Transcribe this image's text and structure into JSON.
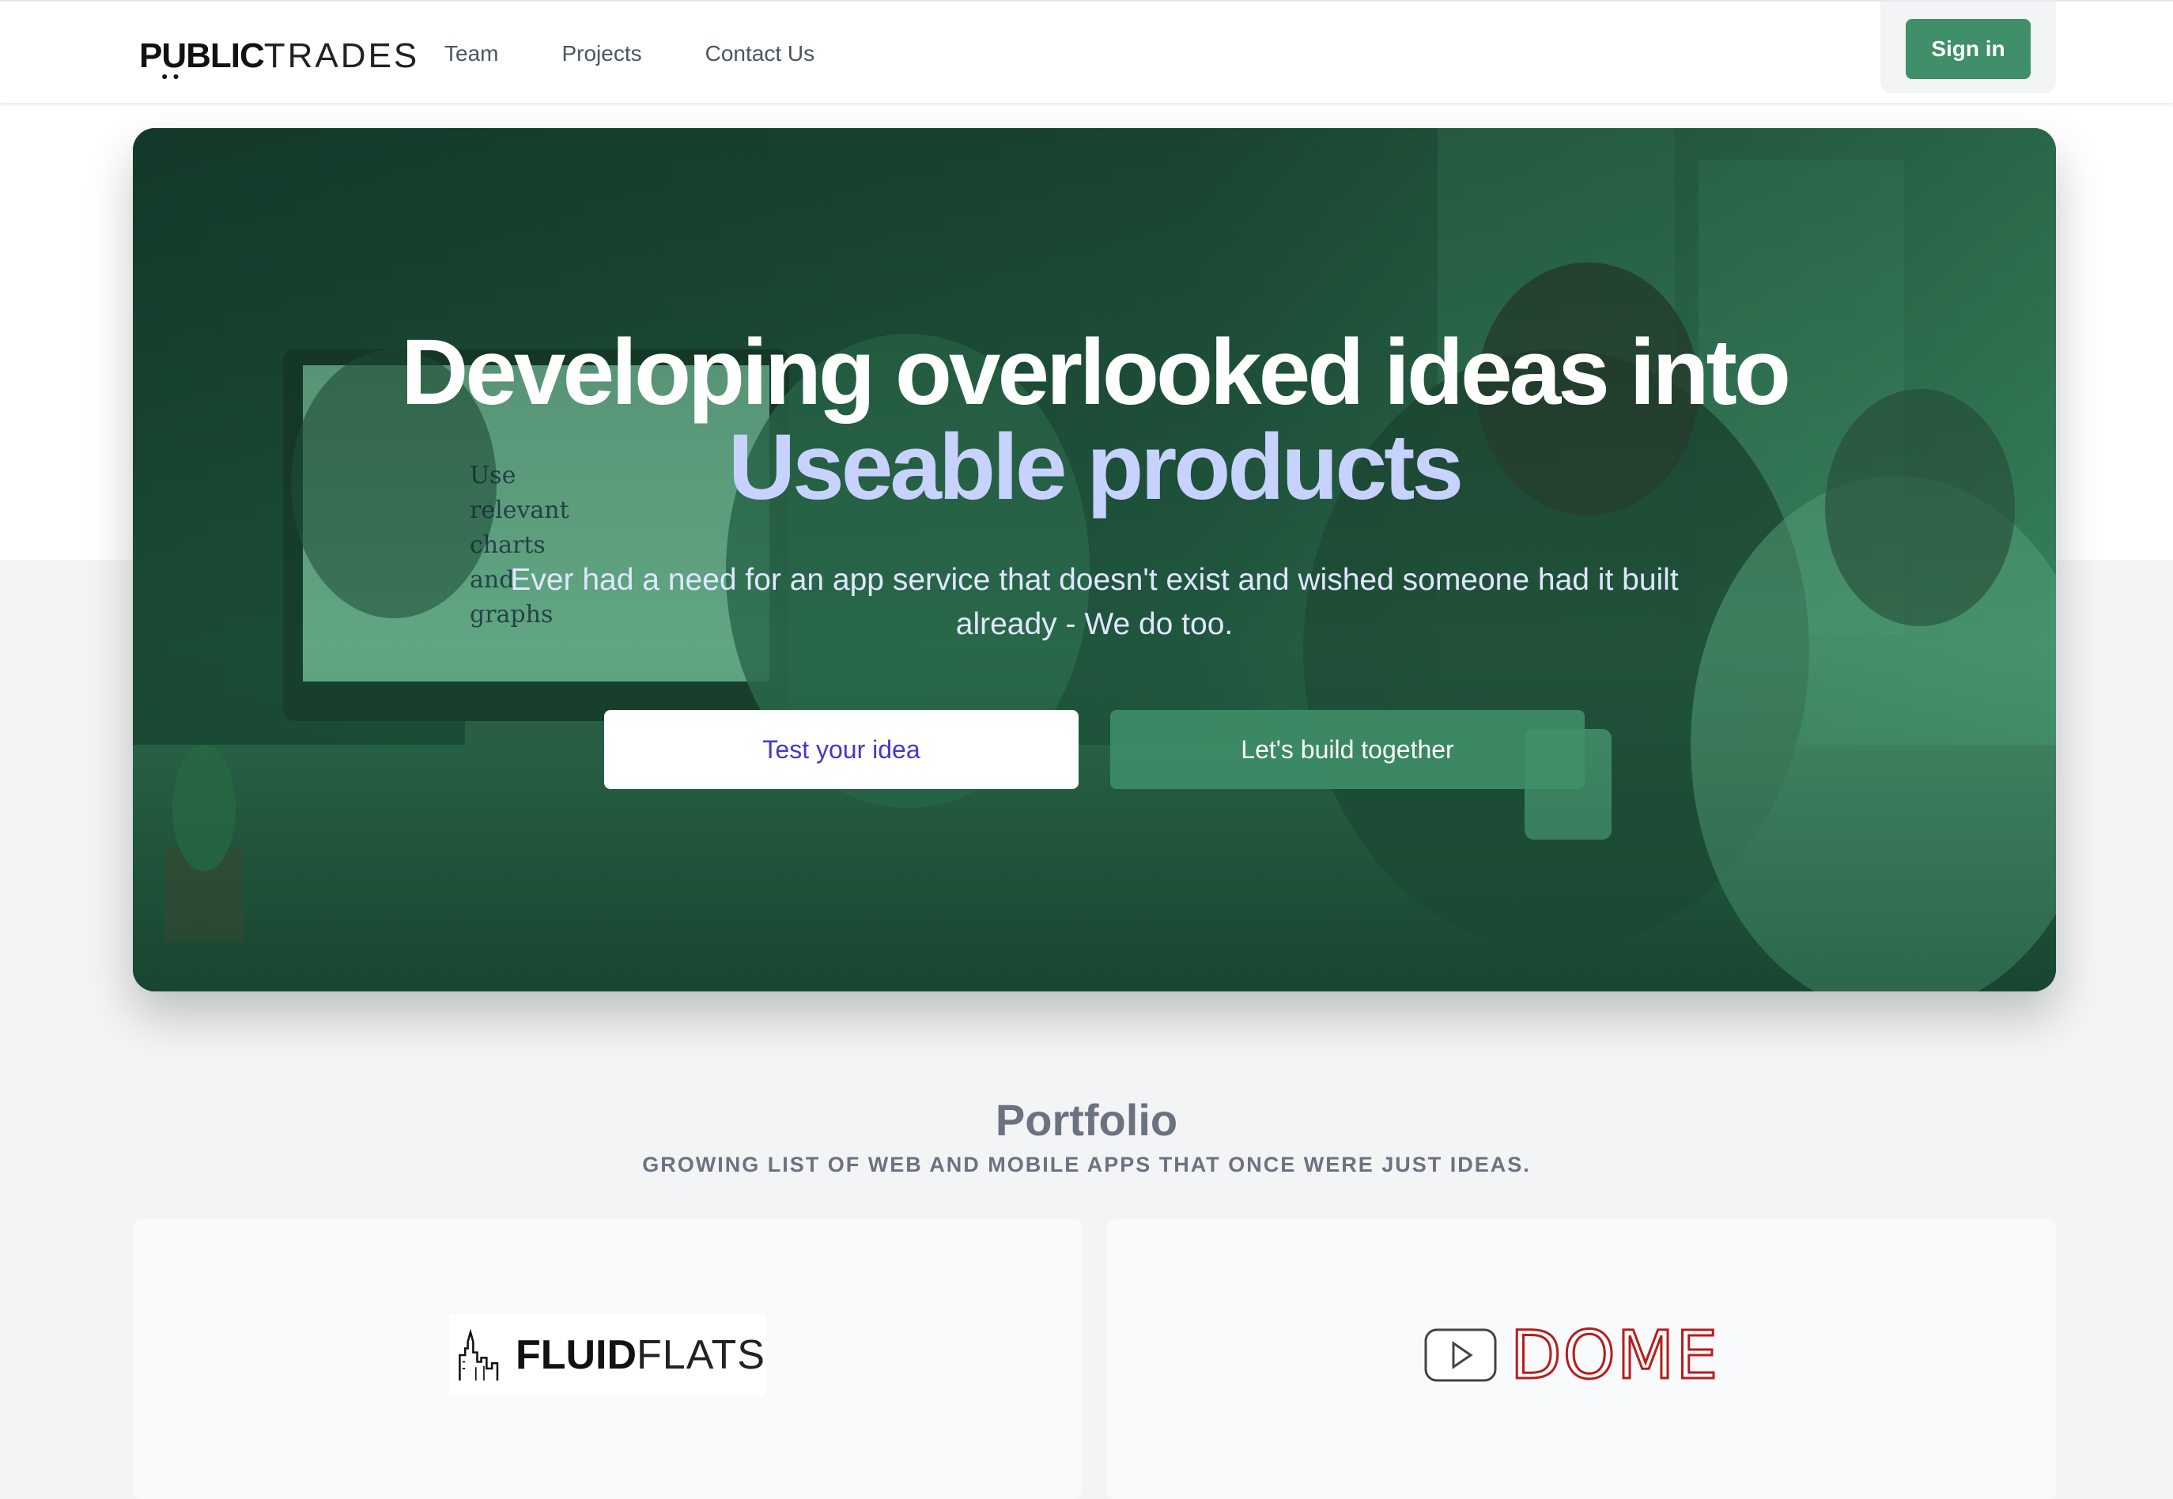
{
  "nav": {
    "logo_text_bold": "PUBLIC",
    "logo_text_thin": "TRADES",
    "links": [
      "Team",
      "Projects",
      "Contact Us"
    ],
    "signin_label": "Sign in"
  },
  "hero": {
    "title_line1": "Developing overlooked ideas into",
    "title_line2": "Useable products",
    "subtitle": "Ever had a need for an app service that doesn't exist and wished someone had it built already - We do too.",
    "primary_button": "Test your idea",
    "secondary_button": "Let's build together",
    "screen_text": [
      "Use",
      "relevant",
      "charts",
      "and",
      "graphs"
    ]
  },
  "portfolio": {
    "title": "Portfolio",
    "subtitle": "GROWING LIST OF WEB AND MOBILE APPS THAT ONCE WERE JUST IDEAS.",
    "projects": [
      {
        "logo_bold": "FLUID",
        "logo_thin": "FLATS"
      },
      {
        "logo_text": "DOME"
      }
    ]
  },
  "colors": {
    "accent_green": "#3f8f69",
    "hero_highlight": "#c7d2fe",
    "primary_button_text": "#4338ca",
    "dome_red": "#b91c1c"
  }
}
